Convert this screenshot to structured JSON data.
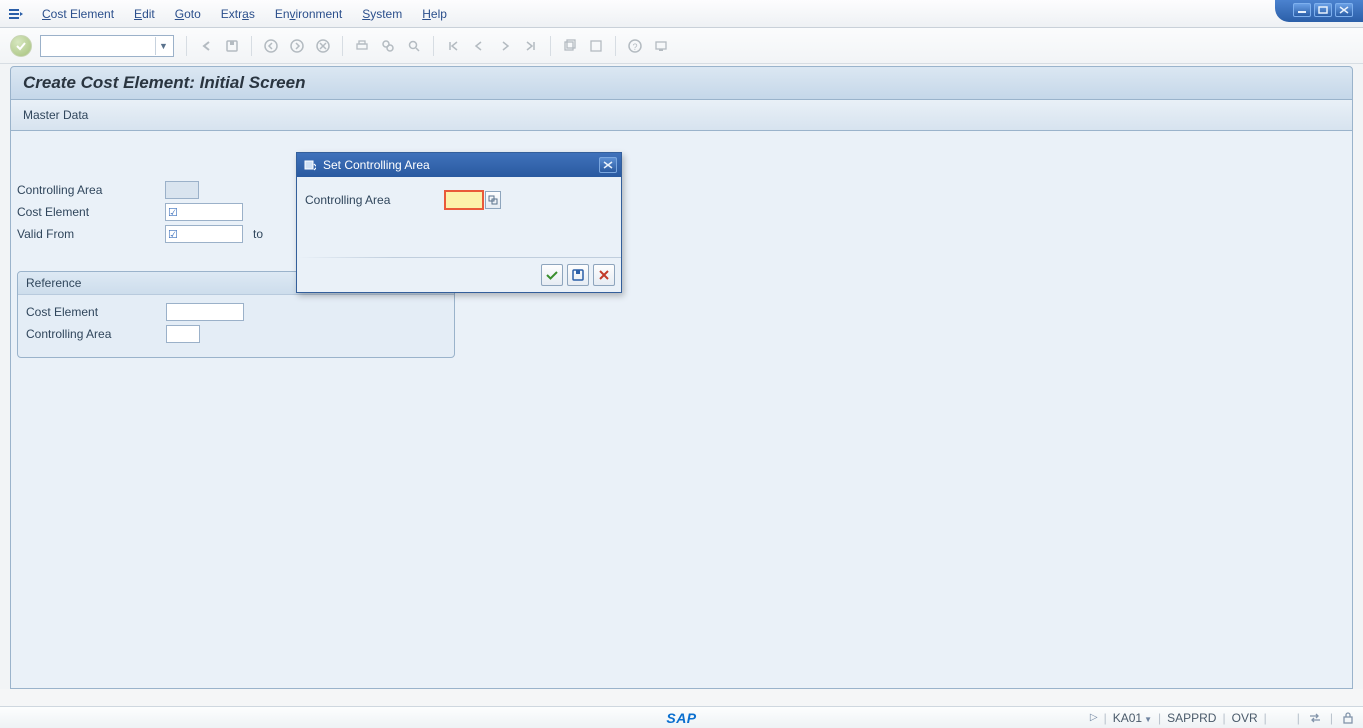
{
  "menu": {
    "items": [
      {
        "letter": "C",
        "rest": "ost Element"
      },
      {
        "letter": "E",
        "rest": "dit"
      },
      {
        "letter": "G",
        "rest": "oto"
      },
      {
        "letter": "",
        "rest": "Extr",
        "letter2": "a",
        "rest2": "s"
      },
      {
        "letter": "",
        "rest": "En",
        "letter2": "v",
        "rest2": "ironment"
      },
      {
        "letter": "S",
        "rest": "ystem"
      },
      {
        "letter": "H",
        "rest": "elp"
      }
    ]
  },
  "title": "Create Cost Element: Initial Screen",
  "sub_toolbar": {
    "master_data_label": "Master Data"
  },
  "main": {
    "controlling_area_label": "Controlling Area",
    "cost_element_label": "Cost Element",
    "valid_from_label": "Valid From",
    "to_label": "to",
    "reference_title": "Reference",
    "ref_cost_element_label": "Cost Element",
    "ref_controlling_area_label": "Controlling Area",
    "cost_element_value": "",
    "valid_from_value": "",
    "valid_to_value": "",
    "ref_cost_element_value": "",
    "ref_controlling_area_value": ""
  },
  "dialog": {
    "title": "Set Controlling Area",
    "controlling_area_label": "Controlling Area",
    "controlling_area_value": ""
  },
  "status": {
    "tcode": "KA01",
    "system": "SAPPRD",
    "mode": "OVR"
  }
}
